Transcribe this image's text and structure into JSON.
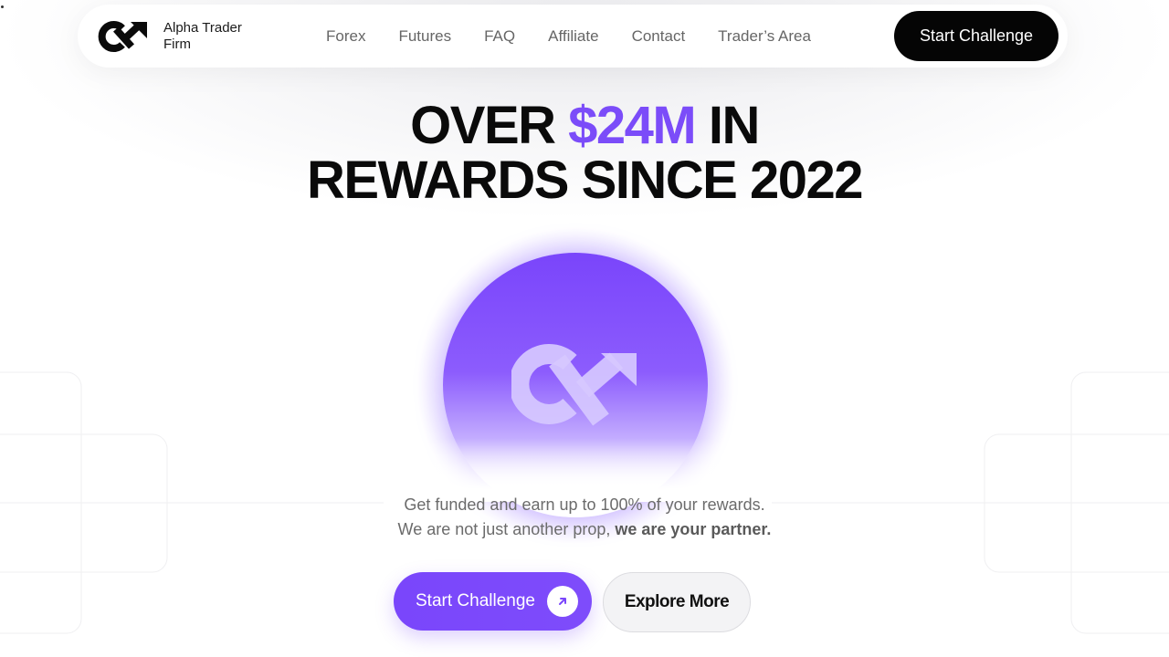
{
  "brand": {
    "name": "Alpha Trader Firm",
    "logo_icon": "alpha-arrow-logo-icon"
  },
  "nav": {
    "links": [
      "Forex",
      "Futures",
      "FAQ",
      "Affiliate",
      "Contact",
      "Trader’s Area"
    ],
    "cta_label": "Start Challenge"
  },
  "hero": {
    "title_part1": "OVER ",
    "title_accent": "$24M",
    "title_part2": " IN",
    "title_line2": "REWARDS SINCE 2022",
    "tagline_line1": "Get funded and earn up to 100% of your rewards.",
    "tagline_line2_prefix": "We are not just another prop, ",
    "tagline_line2_bold": "we are your partner.",
    "primary_button": "Start Challenge",
    "secondary_button": "Explore More"
  },
  "colors": {
    "accent": "#7b4cf9",
    "cta_dark": "#050505",
    "button_secondary_bg": "#f3f3f5"
  }
}
